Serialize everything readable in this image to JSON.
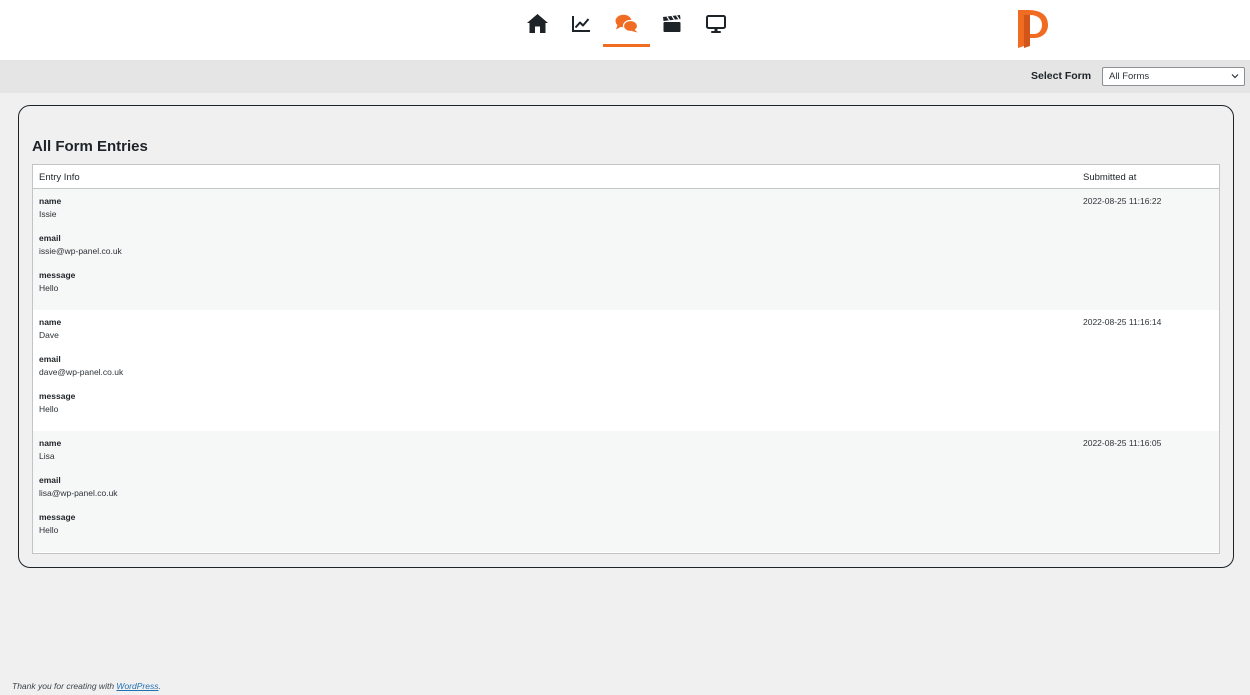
{
  "nav": {
    "items": [
      {
        "icon": "home-icon"
      },
      {
        "icon": "chart-line-icon"
      },
      {
        "icon": "comments-icon",
        "active": true
      },
      {
        "icon": "clapperboard-icon"
      },
      {
        "icon": "desktop-icon"
      }
    ],
    "accent": "#ef6c22"
  },
  "form_select": {
    "label": "Select Form",
    "selected": "All Forms"
  },
  "card": {
    "title": "All Form Entries"
  },
  "table": {
    "columns": [
      "Entry Info",
      "Submitted at"
    ],
    "rows": [
      {
        "fields": [
          {
            "key": "name",
            "value": "Issie"
          },
          {
            "key": "email",
            "value": "issie@wp-panel.co.uk"
          },
          {
            "key": "message",
            "value": "Hello"
          }
        ],
        "submitted_at": "2022-08-25 11:16:22"
      },
      {
        "fields": [
          {
            "key": "name",
            "value": "Dave"
          },
          {
            "key": "email",
            "value": "dave@wp-panel.co.uk"
          },
          {
            "key": "message",
            "value": "Hello"
          }
        ],
        "submitted_at": "2022-08-25 11:16:14"
      },
      {
        "fields": [
          {
            "key": "name",
            "value": "Lisa"
          },
          {
            "key": "email",
            "value": "lisa@wp-panel.co.uk"
          },
          {
            "key": "message",
            "value": "Hello"
          }
        ],
        "submitted_at": "2022-08-25 11:16:05"
      }
    ]
  },
  "footer": {
    "text": "Thank you for creating with ",
    "link": "WordPress",
    "suffix": "."
  }
}
